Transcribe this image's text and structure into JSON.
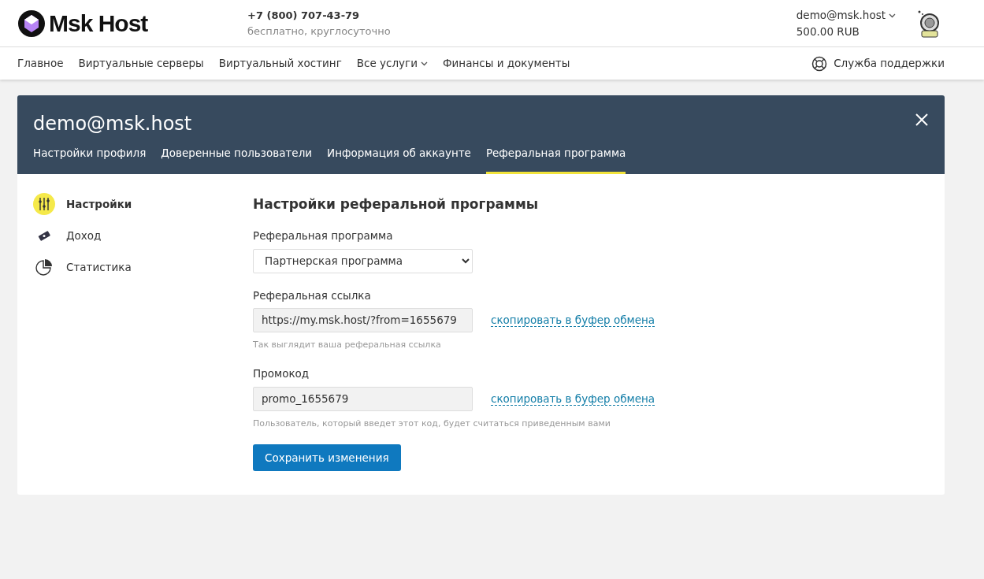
{
  "header": {
    "logo": "Msk Host",
    "phone": "+7 (800) 707-43-79",
    "phone_note": "бесплатно, круглосуточно",
    "account": "demo@msk.host",
    "balance": "500.00 RUB"
  },
  "nav": {
    "items": [
      {
        "label": "Главное",
        "kind": "link"
      },
      {
        "label": "Виртуальные серверы",
        "kind": "link"
      },
      {
        "label": "Виртуальный хостинг",
        "kind": "link"
      },
      {
        "label": "Все услуги",
        "kind": "dropdown"
      },
      {
        "label": "Финансы и документы",
        "kind": "link"
      }
    ],
    "support": "Служба поддержки"
  },
  "panel": {
    "title": "demo@msk.host",
    "tabs": [
      {
        "label": "Настройки профиля",
        "selected": false
      },
      {
        "label": "Доверенные пользователи",
        "selected": false
      },
      {
        "label": "Информация об аккаунте",
        "selected": false
      },
      {
        "label": "Реферальная программа",
        "selected": true
      }
    ]
  },
  "sidebar": {
    "items": [
      {
        "label": "Настройки",
        "kind": "settings",
        "selected": true
      },
      {
        "label": "Доход",
        "kind": "income",
        "selected": false
      },
      {
        "label": "Статистика",
        "kind": "stats",
        "selected": false
      }
    ]
  },
  "form": {
    "heading": "Настройки реферальной программы",
    "fields": [
      {
        "kind": "select",
        "label": "Реферальная программа",
        "value": "Партнерская программа"
      },
      {
        "kind": "copy",
        "label": "Реферальная ссылка",
        "value": "https://my.msk.host/?from=1655679",
        "action": "скопировать в буфер обмена",
        "hint": "Так выглядит ваша реферальная ссылка"
      },
      {
        "kind": "copy",
        "label": "Промокод",
        "value": "promo_1655679",
        "action": "скопировать в буфер обмена",
        "hint": "Пользователь, который введет этот код, будет считаться приведенным вами"
      }
    ],
    "save_button": "Сохранить изменения"
  }
}
